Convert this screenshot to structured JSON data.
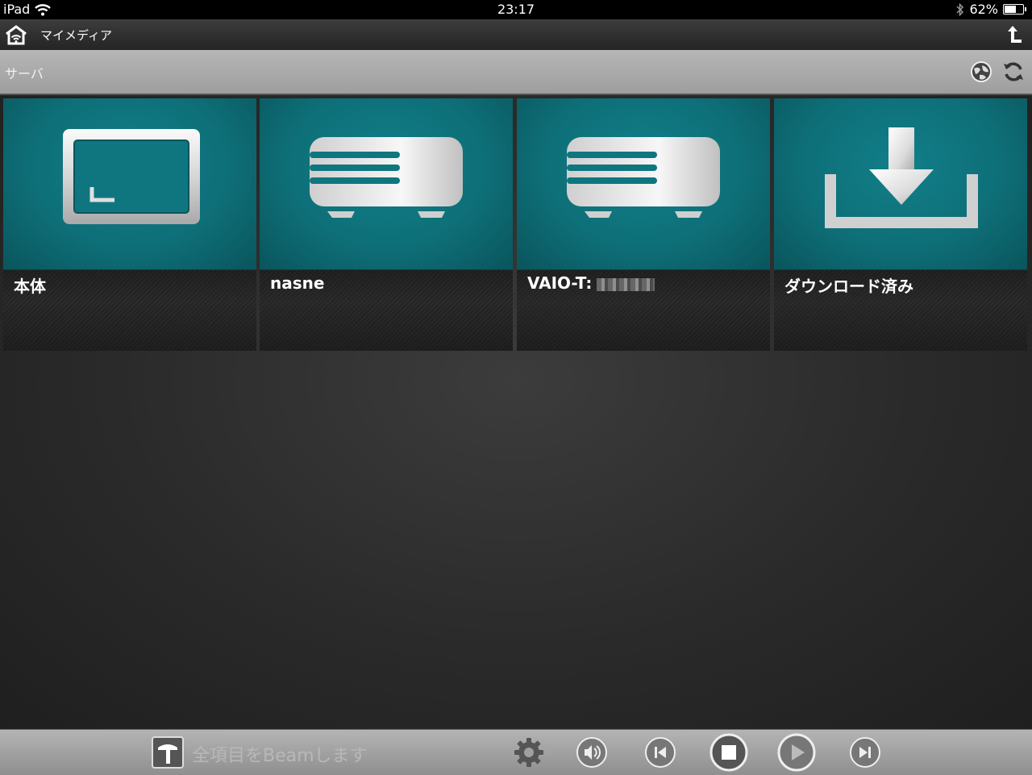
{
  "status_bar": {
    "device": "iPad",
    "time": "23:17",
    "battery": "62%",
    "battery_level": 0.62
  },
  "nav_bar": {
    "title": "マイメディア"
  },
  "server_bar": {
    "label": "サーバ"
  },
  "tiles": [
    {
      "name": "本体",
      "icon": "tablet-icon"
    },
    {
      "name": "nasne",
      "icon": "server-device-icon"
    },
    {
      "name": "VAIO-T:",
      "icon": "server-device-icon"
    },
    {
      "name": "ダウンロード済み",
      "icon": "download-icon"
    }
  ],
  "toolbar": {
    "beam_label": "全項目をBeamします"
  },
  "colors": {
    "tile_teal": "#0e6f78",
    "toolbar_gray": "#a0a0a0"
  }
}
